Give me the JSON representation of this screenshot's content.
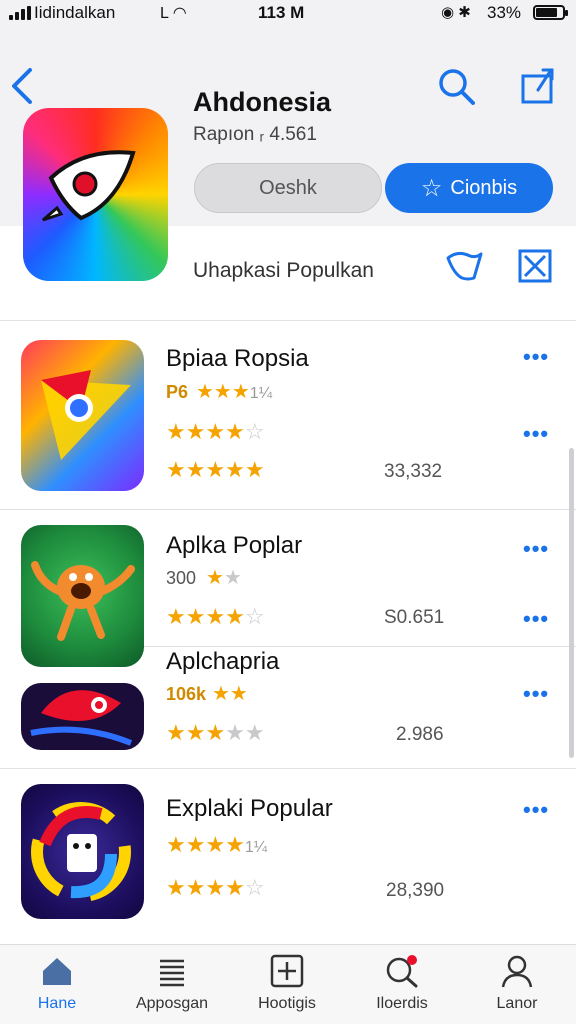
{
  "status_bar": {
    "carrier": "Iidindalkan",
    "time": "113 M",
    "battery": "33%"
  },
  "header": {
    "app_title": "Ahdonesia",
    "app_subtitle": "Rapıon ᵣ 4.561",
    "secondary_button": "Oeshk",
    "primary_button": "Cionbis",
    "section_label": "Uhapkasi Populkan"
  },
  "apps": [
    {
      "name": "Bpiaa Ropsia",
      "meta": "P6",
      "stars_row1": 4,
      "meta_suffix": "1¼",
      "stars_row2": 4,
      "stars_row3": 5,
      "count": "33,332"
    },
    {
      "name": "Aplka Poplar",
      "meta": "300",
      "stars_row1": 1.5,
      "stars_row2": 4.5,
      "count": "S0.651"
    },
    {
      "name": "Aplchapria",
      "meta": "106k",
      "stars_row1": 2,
      "stars_row2": 3.5,
      "count": "2.986"
    },
    {
      "name": "Explaki Popular",
      "stars_row1": 4,
      "meta_suffix": "1¼",
      "stars_row2": 4.5,
      "count": "28,390"
    }
  ],
  "tabs": [
    {
      "label": "Hane",
      "icon": "home-icon"
    },
    {
      "label": "Apposgan",
      "icon": "list-icon"
    },
    {
      "label": "Hootigis",
      "icon": "plus-square-icon"
    },
    {
      "label": "Iloerdis",
      "icon": "search-badge-icon"
    },
    {
      "label": "Lanor",
      "icon": "person-icon"
    }
  ],
  "colors": {
    "accent": "#1a73e8",
    "star": "#f5a300",
    "header_bg": "#f2f2f4"
  }
}
